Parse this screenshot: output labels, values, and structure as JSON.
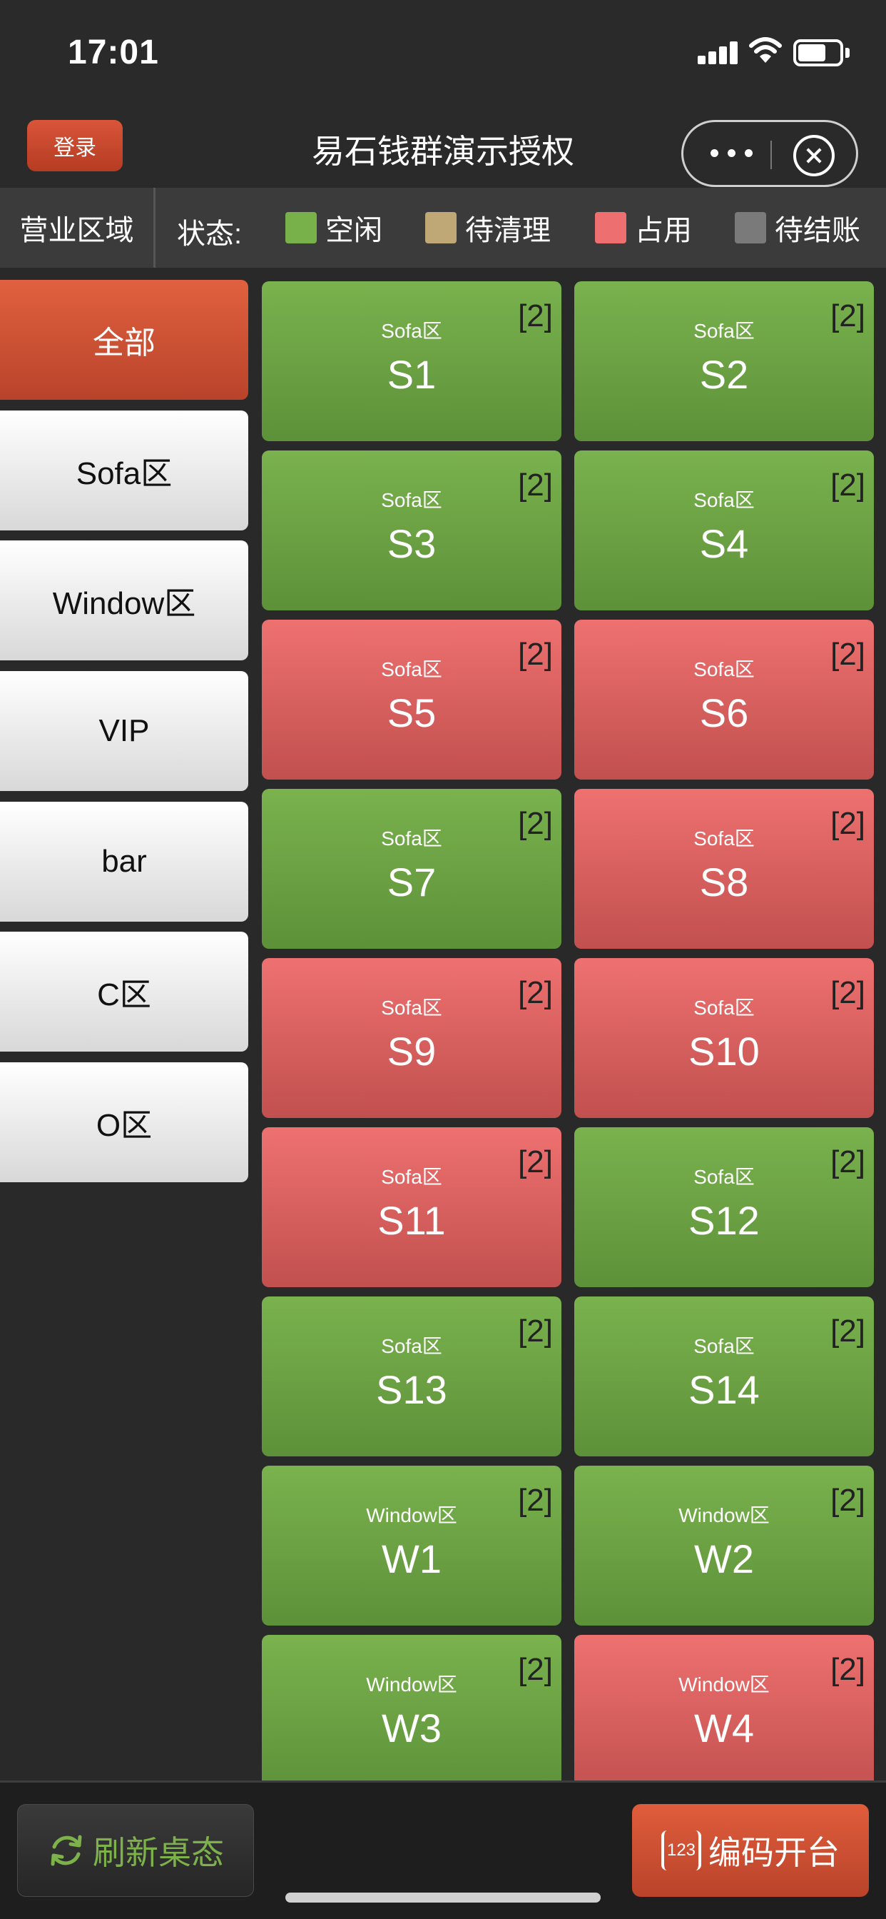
{
  "status_bar": {
    "time": "17:01"
  },
  "header": {
    "login_label": "登录",
    "title": "易石钱群演示授权"
  },
  "legend": {
    "area_label": "营业区域",
    "status_label": "状态:",
    "items": [
      {
        "label": "空闲",
        "color": "#78b04a"
      },
      {
        "label": "待清理",
        "color": "#bfa776"
      },
      {
        "label": "占用",
        "color": "#ee6f6f"
      },
      {
        "label": "待结账",
        "color": "#7a7a7a"
      }
    ]
  },
  "sidebar": {
    "items": [
      {
        "label": "全部",
        "active": true
      },
      {
        "label": "Sofa区",
        "active": false
      },
      {
        "label": "Window区",
        "active": false
      },
      {
        "label": "VIP",
        "active": false
      },
      {
        "label": "bar",
        "active": false
      },
      {
        "label": "C区",
        "active": false
      },
      {
        "label": "O区",
        "active": false
      }
    ]
  },
  "tables": [
    {
      "zone": "Sofa区",
      "name": "S1",
      "seats": "[2]",
      "status": "idle"
    },
    {
      "zone": "Sofa区",
      "name": "S2",
      "seats": "[2]",
      "status": "idle"
    },
    {
      "zone": "Sofa区",
      "name": "S3",
      "seats": "[2]",
      "status": "idle"
    },
    {
      "zone": "Sofa区",
      "name": "S4",
      "seats": "[2]",
      "status": "idle"
    },
    {
      "zone": "Sofa区",
      "name": "S5",
      "seats": "[2]",
      "status": "occupied"
    },
    {
      "zone": "Sofa区",
      "name": "S6",
      "seats": "[2]",
      "status": "occupied"
    },
    {
      "zone": "Sofa区",
      "name": "S7",
      "seats": "[2]",
      "status": "idle"
    },
    {
      "zone": "Sofa区",
      "name": "S8",
      "seats": "[2]",
      "status": "occupied"
    },
    {
      "zone": "Sofa区",
      "name": "S9",
      "seats": "[2]",
      "status": "occupied"
    },
    {
      "zone": "Sofa区",
      "name": "S10",
      "seats": "[2]",
      "status": "occupied"
    },
    {
      "zone": "Sofa区",
      "name": "S11",
      "seats": "[2]",
      "status": "occupied"
    },
    {
      "zone": "Sofa区",
      "name": "S12",
      "seats": "[2]",
      "status": "idle"
    },
    {
      "zone": "Sofa区",
      "name": "S13",
      "seats": "[2]",
      "status": "idle"
    },
    {
      "zone": "Sofa区",
      "name": "S14",
      "seats": "[2]",
      "status": "idle"
    },
    {
      "zone": "Window区",
      "name": "W1",
      "seats": "[2]",
      "status": "idle"
    },
    {
      "zone": "Window区",
      "name": "W2",
      "seats": "[2]",
      "status": "idle"
    },
    {
      "zone": "Window区",
      "name": "W3",
      "seats": "[2]",
      "status": "idle"
    },
    {
      "zone": "Window区",
      "name": "W4",
      "seats": "[2]",
      "status": "occupied"
    }
  ],
  "bottom_bar": {
    "refresh_label": "刷新桌态",
    "numpad_icon_text": "123",
    "open_label": "编码开台"
  }
}
